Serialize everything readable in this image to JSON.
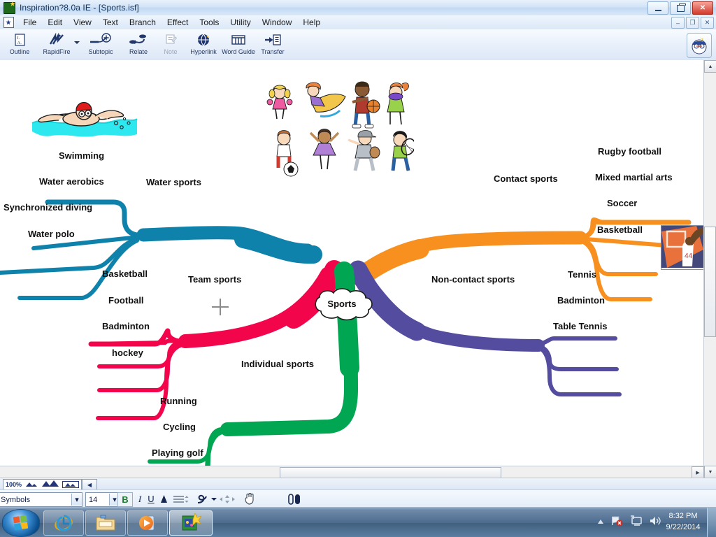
{
  "window": {
    "title": "Inspiration?8.0a IE - [Sports.isf]",
    "app_icon": "inspiration-star-icon",
    "controls": {
      "minimize": "–",
      "restore": "❐",
      "close": "✕"
    },
    "mdi_controls": {
      "minimize": "–",
      "restore": "❐",
      "close": "✕"
    }
  },
  "menubar": {
    "doc_icon": "document-star-icon",
    "items": [
      "File",
      "Edit",
      "View",
      "Text",
      "Branch",
      "Effect",
      "Tools",
      "Utility",
      "Window",
      "Help"
    ]
  },
  "toolbar": {
    "buttons": [
      {
        "label": "Outline",
        "icon": "outline-icon",
        "enabled": true
      },
      {
        "label": "RapidFire",
        "icon": "rapidfire-lightning-icon",
        "enabled": true,
        "has_dropdown": true
      },
      {
        "label": "Subtopic",
        "icon": "subtopic-plus-icon",
        "enabled": true
      },
      {
        "label": "Relate",
        "icon": "relate-arrow-icon",
        "enabled": true
      },
      {
        "label": "Note",
        "icon": "note-icon",
        "enabled": false
      },
      {
        "label": "Hyperlink",
        "icon": "hyperlink-globe-icon",
        "enabled": true
      },
      {
        "label": "Word Guide",
        "icon": "word-guide-book-icon",
        "enabled": true
      },
      {
        "label": "Transfer",
        "icon": "transfer-icon",
        "enabled": true
      }
    ],
    "app_badge_icon": "inspiration-mascot-icon"
  },
  "mindmap": {
    "center": {
      "label": "Sports",
      "shape": "cloud"
    },
    "branches": [
      {
        "label": "Water sports",
        "color": "#0e82ab",
        "side": "left",
        "children": [
          "Swimming",
          "Water aerobics",
          "Synchronized diving",
          "Water polo"
        ]
      },
      {
        "label": "Team sports",
        "color": "#f3054c",
        "side": "left",
        "children": [
          "Basketball",
          "Football",
          "Badminton",
          "hockey"
        ]
      },
      {
        "label": "Individual sports",
        "color": "#00a651",
        "side": "left",
        "children": [
          "Running",
          "Cycling",
          "Playing golf"
        ]
      },
      {
        "label": "Contact sports",
        "color": "#f7901e",
        "side": "right",
        "children": [
          "Rugby football",
          "Mixed martial arts",
          "Soccer",
          "Basketball"
        ]
      },
      {
        "label": "Non-contact sports",
        "color": "#544c9e",
        "side": "right",
        "children": [
          "Tennis",
          "Badminton",
          "Table Tennis"
        ]
      }
    ],
    "images": [
      {
        "name": "swimmer-clipart",
        "alt": "cartoon swimmer in water"
      },
      {
        "name": "kids-sports-clipart",
        "alt": "eight cartoon children playing sports"
      },
      {
        "name": "basketball-player-photo",
        "alt": "basketball player dunking"
      }
    ]
  },
  "statusbar": {
    "zoom": "100%",
    "zoom_out_icon": "small-mountains-icon",
    "zoom_in_icon": "large-mountains-icon",
    "zoom_fit_icon": "fit-page-icon",
    "collapse_icon": "left-arrow-icon"
  },
  "formatbar": {
    "font_family": "Symbols",
    "font_size": "14",
    "bold": "B",
    "italic": "I",
    "underline": "U",
    "text_color_icon": "font-color-icon",
    "align_icon": "align-lines-icon",
    "style_icon": "style-brush-icon",
    "arrange_icon": "arrange-arrows-icon",
    "hand_icon": "hand-pan-icon",
    "position_icon": "position-icon"
  },
  "taskbar": {
    "start_icon": "windows-start-orb",
    "quicklaunch": [
      {
        "name": "internet-explorer-icon",
        "label": "Internet Explorer"
      }
    ],
    "tasks": [
      {
        "name": "file-explorer-icon",
        "label": "Windows Explorer",
        "active": false
      },
      {
        "name": "media-player-icon",
        "label": "Windows Media Player",
        "active": false
      },
      {
        "name": "inspiration-icon",
        "label": "Inspiration",
        "active": true
      }
    ],
    "tray": [
      {
        "name": "show-hidden-icons-chevron",
        "label": "Show hidden icons"
      },
      {
        "name": "network-error-icon",
        "label": "Network"
      },
      {
        "name": "display-icon",
        "label": "Display"
      },
      {
        "name": "volume-icon",
        "label": "Volume"
      }
    ],
    "clock": {
      "time": "8:32 PM",
      "date": "9/22/2014"
    }
  }
}
